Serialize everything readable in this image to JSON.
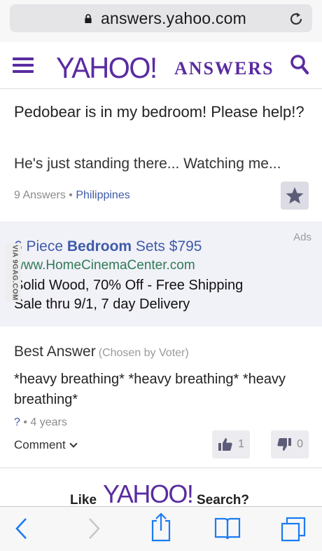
{
  "browser": {
    "url": "answers.yahoo.com",
    "icons": [
      "lock-icon",
      "reload-icon",
      "back-icon",
      "forward-icon",
      "share-icon",
      "bookmarks-icon",
      "tabs-icon"
    ],
    "accent": "#1a7bf2"
  },
  "header": {
    "logo": "YAHOO!",
    "section": "ANSWERS",
    "brand_color": "#5a2ca0"
  },
  "question": {
    "title": "Pedobear is in my bedroom! Please help!?",
    "body": "He's just standing there... Watching me...",
    "answers": "9 Answers",
    "separator": "•",
    "location": "Philippines"
  },
  "ad": {
    "label": "Ads",
    "headline_pre": "6 Piece ",
    "headline_bold": "Bedroom",
    "headline_post": " Sets $795",
    "url": "www.HomeCinemaCenter.com",
    "line1": "Solid Wood, 70% Off - Free Shipping",
    "line2": "Sale thru 9/1, 7 day Delivery"
  },
  "watermark": "VIA 9GAG.COM",
  "best_answer": {
    "heading": "Best Answer",
    "chosen": "(Chosen by Voter)",
    "text": "*heavy breathing* *heavy breathing* *heavy breathing*",
    "author": "?",
    "separator": "•",
    "age": "4 years",
    "comment_label": "Comment",
    "thumbs_up": "1",
    "thumbs_down": "0"
  },
  "promo": {
    "pre": "Like",
    "logo": "YAHOO!",
    "post": "Search?"
  }
}
